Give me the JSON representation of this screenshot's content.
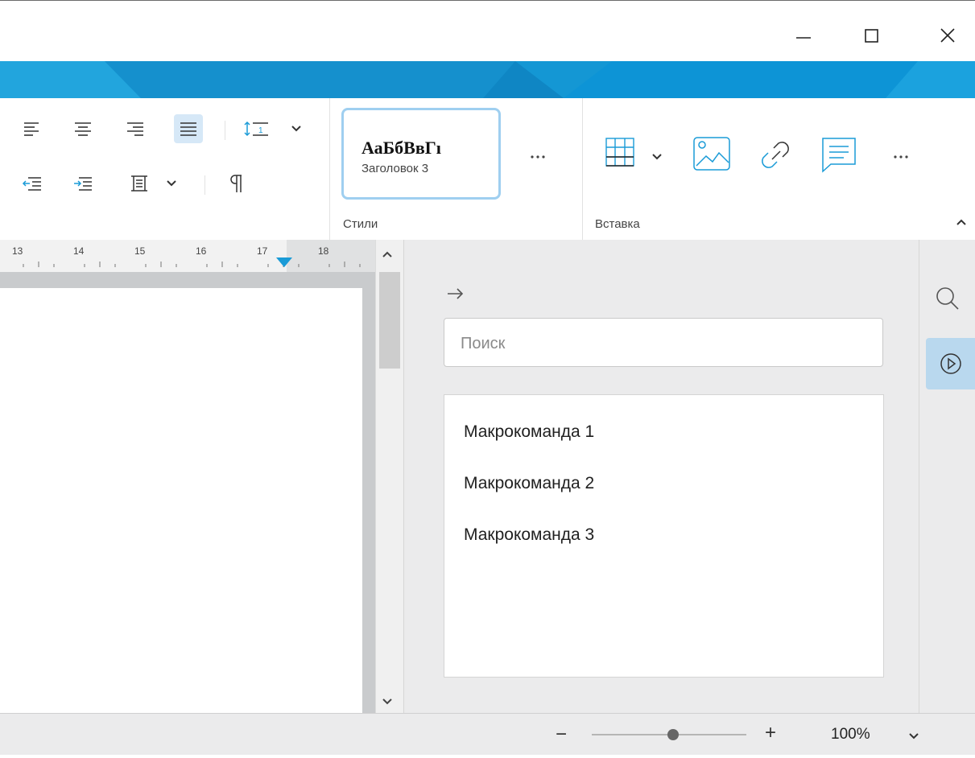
{
  "window": {
    "minimize_icon": "minimize-icon",
    "maximize_icon": "maximize-icon",
    "close_icon": "close-icon"
  },
  "ribbon": {
    "styles": {
      "preview_text": "АаБбВвГı",
      "style_name": "Заголовок 3",
      "group_label": "Стили"
    },
    "insert": {
      "group_label": "Вставка"
    }
  },
  "ruler": {
    "ticks": [
      "13",
      "14",
      "15",
      "16",
      "17",
      "18"
    ]
  },
  "panel": {
    "search_placeholder": "Поиск",
    "macros": [
      "Макрокоманда 1",
      "Макрокоманда 2",
      "Макрокоманда 3"
    ]
  },
  "status": {
    "zoom_minus": "−",
    "zoom_plus": "+",
    "zoom_value": "100%",
    "zoom_level_percent": 100
  },
  "colors": {
    "accent": "#1a9bd7",
    "selected_bg": "#d6e8f7",
    "style_border": "#9fcff0",
    "macro_active_bg": "#b9d8ee"
  }
}
